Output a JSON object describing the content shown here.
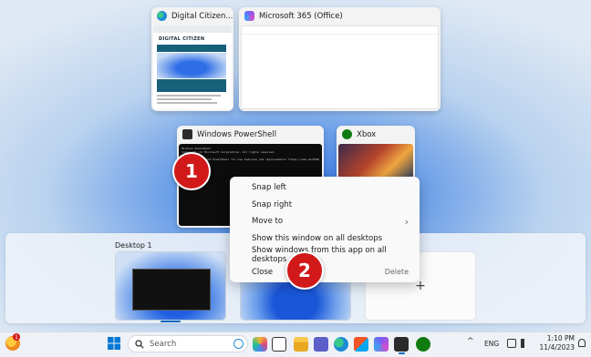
{
  "windows": {
    "digital_citizen": {
      "title": "Digital Citizen...",
      "page_brand": "DIGITAL CITIZEN"
    },
    "microsoft365": {
      "title": "Microsoft 365 (Office)"
    },
    "powershell": {
      "title": "Windows PowerShell",
      "lines": [
        "Windows PowerShell",
        "Copyright (C) Microsoft Corporation. All rights reserved.",
        "",
        "Install the latest PowerShell for new features and improvements! https://aka.ms/PSWindows",
        "",
        "PS C:\\Users\\"
      ]
    },
    "xbox": {
      "title": "Xbox"
    }
  },
  "callouts": {
    "first": "1",
    "second": "2"
  },
  "context_menu": {
    "items": [
      {
        "label": "Snap left",
        "accel": ""
      },
      {
        "label": "Snap right",
        "accel": ""
      },
      {
        "label": "Move to",
        "accel": "›"
      },
      {
        "label": "Show this window on all desktops",
        "accel": ""
      },
      {
        "label": "Show windows from this app on all desktops",
        "accel": ""
      },
      {
        "label": "Close",
        "accel": "Delete"
      }
    ]
  },
  "desktops": {
    "desktop1_label": "Desktop 1",
    "new_desktop_glyph": "+"
  },
  "taskbar": {
    "search_placeholder": "Search",
    "widgets_badge": "1",
    "tray": {
      "language": "ENG",
      "time": "1:10 PM",
      "date": "11/4/2023"
    }
  },
  "colors": {
    "accent": "#0067c0",
    "badge_red": "#d11919",
    "edge_blue": "#1f8ad6",
    "xbox_green": "#107c10"
  }
}
